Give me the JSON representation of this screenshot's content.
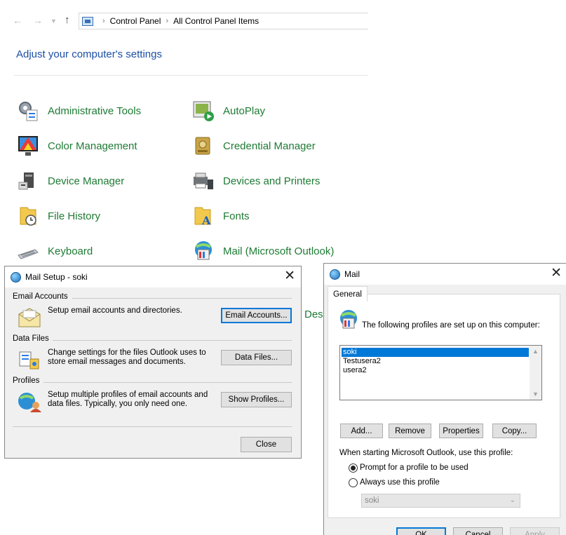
{
  "control_panel": {
    "breadcrumb": [
      "Control Panel",
      "All Control Panel Items"
    ],
    "heading": "Adjust your computer's settings",
    "items_left": [
      "Administrative Tools",
      "Color Management",
      "Device Manager",
      "File History",
      "Keyboard"
    ],
    "items_right": [
      "AutoPlay",
      "Credential Manager",
      "Devices and Printers",
      "Fonts",
      "Mail (Microsoft Outlook)"
    ],
    "partial_item": "Des"
  },
  "mail_setup": {
    "title": "Mail Setup - soki",
    "email_accounts": {
      "label": "Email Accounts",
      "description": "Setup email accounts and directories.",
      "button": "Email Accounts..."
    },
    "data_files": {
      "label": "Data Files",
      "description": "Change settings for the files Outlook uses to store email messages and documents.",
      "button": "Data Files..."
    },
    "profiles": {
      "label": "Profiles",
      "description": "Setup multiple profiles of email accounts and data files. Typically, you only need one.",
      "button": "Show Profiles..."
    },
    "close_button": "Close"
  },
  "mail": {
    "title": "Mail",
    "tab": "General",
    "profiles_heading": "The following profiles are set up on this computer:",
    "profiles": [
      "soki",
      "Testusera2",
      "usera2"
    ],
    "selected_profile_index": 0,
    "buttons": {
      "add": "Add...",
      "remove": "Remove",
      "properties": "Properties",
      "copy": "Copy..."
    },
    "startup_label": "When starting Microsoft Outlook, use this profile:",
    "option_prompt": "Prompt for a profile to be used",
    "option_always": "Always use this profile",
    "selected_option": "prompt",
    "always_profile_value": "soki",
    "bottom_buttons": {
      "ok": "OK",
      "cancel": "Cancel",
      "apply": "Apply"
    }
  }
}
